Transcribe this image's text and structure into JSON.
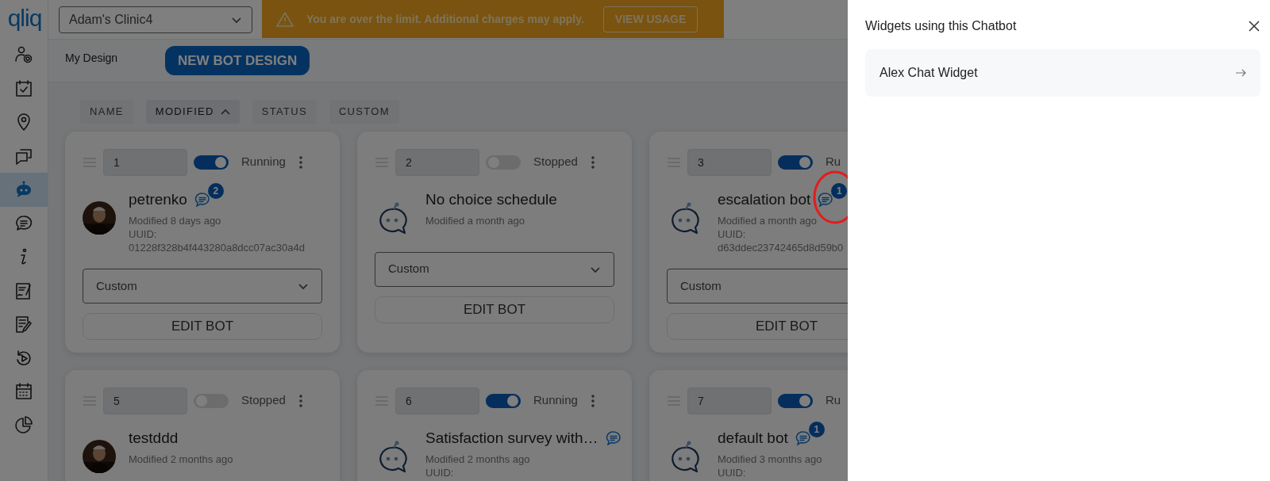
{
  "sidebar": {
    "logo": "qliq",
    "items": [
      {
        "kind": "user-settings",
        "selected": false
      },
      {
        "kind": "calendar-check",
        "selected": false
      },
      {
        "kind": "location",
        "selected": false
      },
      {
        "kind": "chats",
        "selected": false
      },
      {
        "kind": "bot",
        "selected": true
      },
      {
        "kind": "chat",
        "selected": false
      },
      {
        "kind": "info",
        "selected": false
      },
      {
        "kind": "sign",
        "selected": false
      },
      {
        "kind": "edit",
        "selected": false
      },
      {
        "kind": "replay",
        "selected": false
      },
      {
        "kind": "calendar",
        "selected": false
      },
      {
        "kind": "pie",
        "selected": false
      }
    ]
  },
  "topbar": {
    "practice": "Adam's Clinic4",
    "banner": {
      "message": "You are over the limit. Additional charges may apply.",
      "action": "VIEW USAGE"
    }
  },
  "toolbar": {
    "title": "My Design",
    "button": "NEW BOT DESIGN"
  },
  "sort": [
    {
      "label": "NAME",
      "selected": false
    },
    {
      "label": "MODIFIED",
      "selected": true
    },
    {
      "label": "STATUS",
      "selected": false
    },
    {
      "label": "CUSTOM",
      "selected": false
    }
  ],
  "cards": [
    {
      "order": "1",
      "running": true,
      "status": "Running",
      "name": "petrenko",
      "has_widgets": true,
      "widget_count": "2",
      "modified": "Modified 8 days ago",
      "uuid_label": "UUID:",
      "uuid": "01228f328b4f443280a8dcc07ac30a4d",
      "template": "Custom",
      "edit": "EDIT BOT"
    },
    {
      "order": "2",
      "running": false,
      "status": "Stopped",
      "name": "No choice schedule",
      "kind": "bot",
      "has_widgets": false,
      "modified": "Modified a month ago",
      "template": "Custom",
      "edit": "EDIT BOT"
    },
    {
      "order": "3",
      "cut_off": true,
      "running": true,
      "status": "Ru",
      "name": "escalation bot",
      "kind": "bot",
      "has_widgets": true,
      "widget_count": "1",
      "highlighted": true,
      "modified": "Modified a month ago",
      "uuid_label": "UUID:",
      "uuid": "d63ddec23742465d8d59b0",
      "template": "Custom",
      "edit": "EDIT BOT"
    },
    {
      "order": "5",
      "running": false,
      "status": "Stopped",
      "name": "testddd",
      "has_widgets": false,
      "modified": "Modified 2 months ago"
    },
    {
      "order": "6",
      "running": true,
      "status": "Running",
      "name": "Satisfaction survey with…",
      "kind": "bot",
      "has_widgets": true,
      "modified": "Modified 2 months ago",
      "uuid_label": "UUID:"
    },
    {
      "order": "7",
      "cut_off": true,
      "running": true,
      "status": "Ru",
      "name": "default bot",
      "kind": "bot",
      "has_widgets": true,
      "widget_count": "1",
      "modified": "Modified 3 months ago",
      "uuid_label": "UUID:"
    }
  ],
  "panel": {
    "title": "Widgets using this Chatbot",
    "widgets": [
      {
        "name": "Alex Chat Widget"
      }
    ]
  }
}
